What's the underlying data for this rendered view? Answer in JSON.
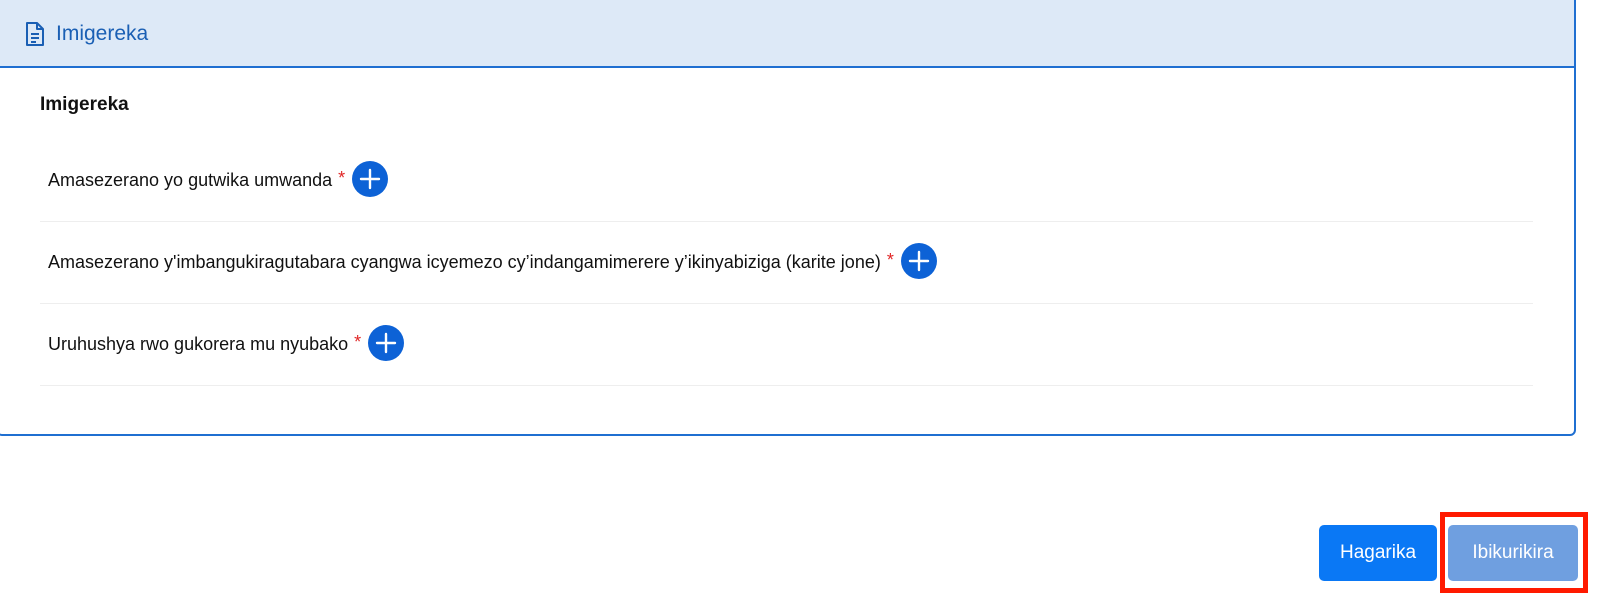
{
  "panel": {
    "header_title": "Imigereka",
    "header_icon": "document-icon",
    "section_title": "Imigereka",
    "documents": [
      {
        "label": "Amasezerano yo gutwika umwanda",
        "required_mark": "*",
        "add_icon": "plus-circle-icon"
      },
      {
        "label": "Amasezerano y'imbangukiragutabara cyangwa icyemezo cy’indangamimerere y’ikinyabiziga (karite jone)",
        "required_mark": "*",
        "add_icon": "plus-circle-icon"
      },
      {
        "label": "Uruhushya rwo gukorera mu nyubako",
        "required_mark": "*",
        "add_icon": "plus-circle-icon"
      }
    ]
  },
  "actions": {
    "cancel_label": "Hagarika",
    "submit_label": "Ibikurikira"
  },
  "colors": {
    "primary": "#0d62d6",
    "header_bg": "#dde9f7",
    "required": "#e02424",
    "submit_disabled": "#6f9fe0",
    "highlight": "#ff1a00"
  }
}
